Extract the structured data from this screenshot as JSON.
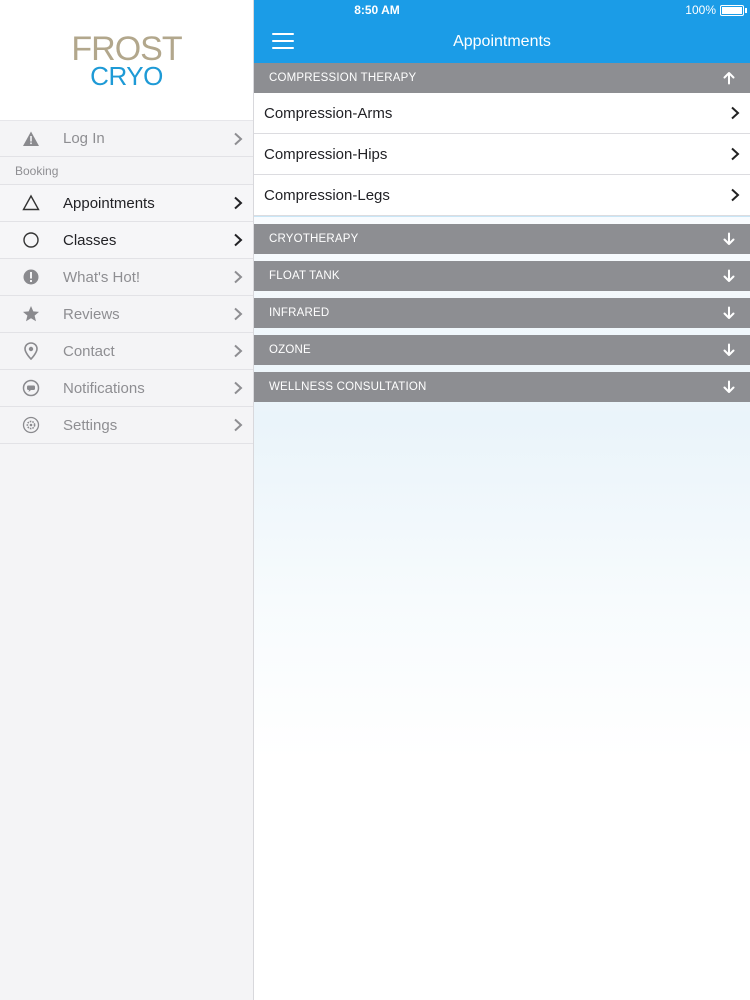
{
  "status_bar": {
    "time": "8:50 AM",
    "battery": "100%"
  },
  "logo": {
    "line1": "FROST",
    "line2": "CRYO",
    "color_top": "#b2a78c",
    "color_bottom": "#1e9ad6"
  },
  "sidebar": {
    "login_label": "Log In",
    "section_label": "Booking",
    "items": [
      {
        "label": "Appointments",
        "icon": "triangle-outline-icon"
      },
      {
        "label": "Classes",
        "icon": "circle-outline-icon"
      },
      {
        "label": "What's Hot!",
        "icon": "exclamation-circle-icon"
      },
      {
        "label": "Reviews",
        "icon": "star-icon"
      },
      {
        "label": "Contact",
        "icon": "location-pin-icon"
      },
      {
        "label": "Notifications",
        "icon": "chat-bubble-icon"
      },
      {
        "label": "Settings",
        "icon": "gear-icon"
      }
    ]
  },
  "nav": {
    "title": "Appointments",
    "accent": "#1b9ce7"
  },
  "categories": [
    {
      "label": "COMPRESSION THERAPY",
      "expanded": true,
      "items": [
        "Compression-Arms",
        "Compression-Hips",
        "Compression-Legs"
      ]
    },
    {
      "label": "CRYOTHERAPY",
      "expanded": false
    },
    {
      "label": "FLOAT TANK",
      "expanded": false
    },
    {
      "label": "INFRARED",
      "expanded": false
    },
    {
      "label": "OZONE",
      "expanded": false
    },
    {
      "label": "WELLNESS CONSULTATION",
      "expanded": false
    }
  ]
}
